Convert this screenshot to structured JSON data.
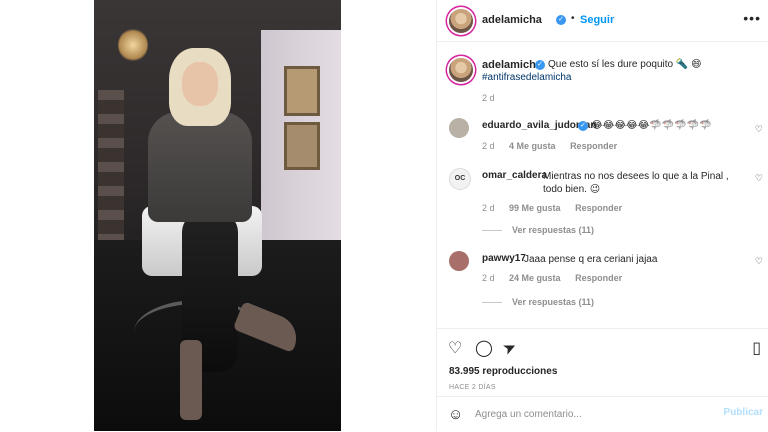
{
  "post": {
    "author": "adelamicha",
    "follow_label": "Seguir",
    "separator": "•",
    "more_icon": "•••",
    "caption_text": "Que esto sí les dure poquito 🔦 😄",
    "hashtag": "#antifrasedelamicha",
    "caption_time": "2 d"
  },
  "comments": [
    {
      "user": "eduardo_avila_judoman",
      "text": "😂😂😂😂😂🦈🦈🦈🦈🦈",
      "time": "2 d",
      "likes": "4 Me gusta",
      "reply": "Responder",
      "avatar_color": "#b9b0a6"
    },
    {
      "user": "omar_caldera",
      "text": "Mientras no nos desees lo que a la Pinal , todo bien. 😉",
      "time": "2 d",
      "likes": "99 Me gusta",
      "reply": "Responder",
      "replies": "Ver respuestas (11)",
      "avatar_color": "#f2f2f2",
      "avatar_text": "OC"
    },
    {
      "user": "pawwy17",
      "text": "Jaaa pense q era ceriani jajaa",
      "time": "2 d",
      "likes": "24 Me gusta",
      "reply": "Responder",
      "replies": "Ver respuestas (11)",
      "avatar_color": "#a86e6a"
    }
  ],
  "actions": {
    "like_icon": "♡",
    "comment_icon": "◯",
    "share_icon": "➤",
    "save_icon": "▯",
    "views": "83.995 reproducciones",
    "ago": "HACE 2 DÍAS"
  },
  "add_comment": {
    "emoji_icon": "☺",
    "placeholder": "Agrega un comentario...",
    "publish": "Publicar"
  },
  "colors": {
    "accent": "#0095f6",
    "verified": "#3897f0",
    "muted": "#8e8e8e"
  }
}
